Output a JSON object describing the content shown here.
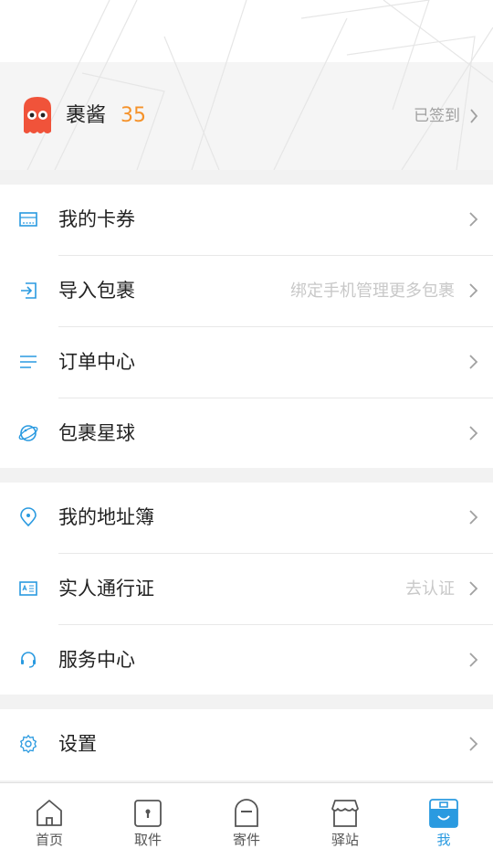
{
  "profile": {
    "username": "裹酱",
    "points": "35",
    "signin_label": "已签到"
  },
  "menu_group_1": {
    "items": [
      {
        "label": "我的卡券",
        "hint": "",
        "icon": "coupon-icon"
      },
      {
        "label": "导入包裹",
        "hint": "绑定手机管理更多包裹",
        "icon": "import-icon"
      },
      {
        "label": "订单中心",
        "hint": "",
        "icon": "list-icon"
      },
      {
        "label": "包裹星球",
        "hint": "",
        "icon": "planet-icon"
      }
    ]
  },
  "menu_group_2": {
    "items": [
      {
        "label": "我的地址簿",
        "hint": "",
        "icon": "location-pin-icon"
      },
      {
        "label": "实人通行证",
        "hint": "去认证",
        "icon": "id-card-icon"
      },
      {
        "label": "服务中心",
        "hint": "",
        "icon": "headset-icon"
      }
    ]
  },
  "menu_group_3": {
    "items": [
      {
        "label": "设置",
        "hint": "",
        "icon": "gear-icon"
      }
    ]
  },
  "tabbar": {
    "tabs": [
      {
        "label": "首页",
        "icon": "home-icon",
        "active": false
      },
      {
        "label": "取件",
        "icon": "pickup-icon",
        "active": false
      },
      {
        "label": "寄件",
        "icon": "send-icon",
        "active": false
      },
      {
        "label": "驿站",
        "icon": "station-icon",
        "active": false
      },
      {
        "label": "我",
        "icon": "me-icon",
        "active": true
      }
    ]
  },
  "colors": {
    "accent": "#2a9ae0",
    "points": "#f5922a",
    "avatar": "#f0533a"
  }
}
